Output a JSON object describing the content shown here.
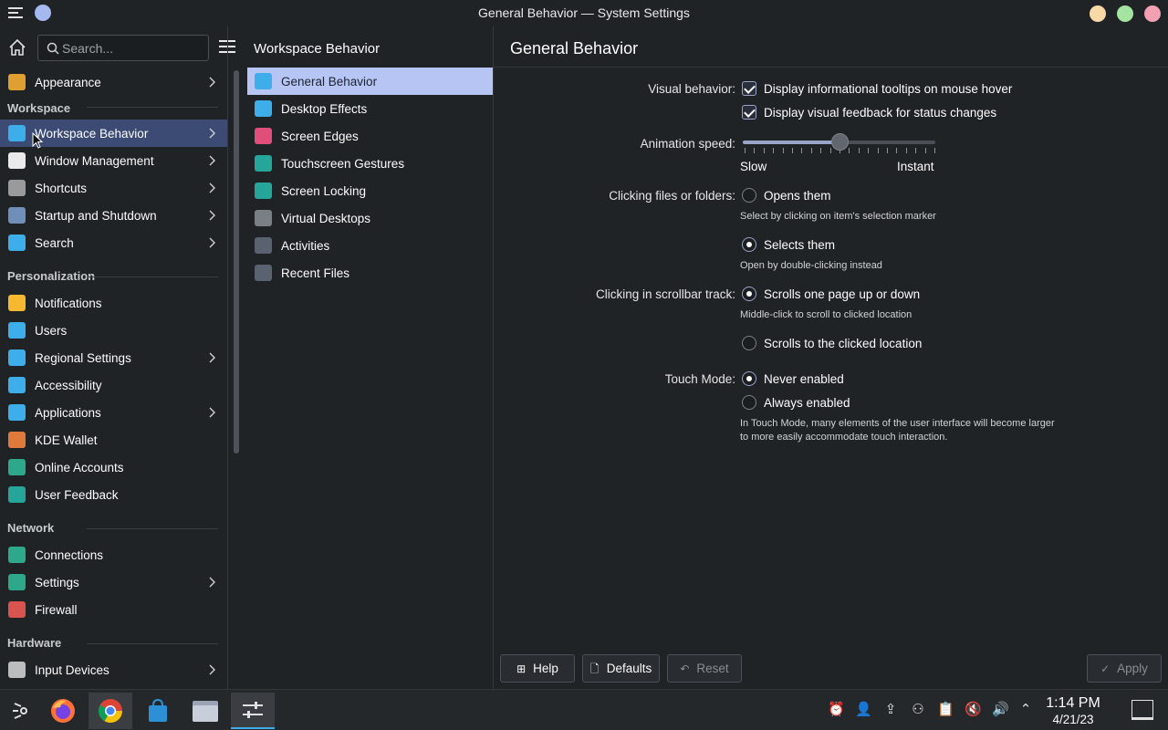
{
  "window": {
    "title": "General Behavior — System Settings"
  },
  "search": {
    "placeholder": "Search..."
  },
  "sidebar": {
    "items": [
      {
        "type": "item",
        "label": "Appearance",
        "chevron": true,
        "icon": "appearance-icon",
        "color": "#e0a030"
      },
      {
        "type": "section",
        "label": "Workspace"
      },
      {
        "type": "item",
        "label": "Workspace Behavior",
        "chevron": true,
        "active": true,
        "icon": "workspace-behavior-icon",
        "color": "#3daee9"
      },
      {
        "type": "item",
        "label": "Window Management",
        "chevron": true,
        "icon": "window-management-icon",
        "color": "#eaeaea"
      },
      {
        "type": "item",
        "label": "Shortcuts",
        "chevron": true,
        "icon": "keyboard-icon",
        "color": "#9a9a9a"
      },
      {
        "type": "item",
        "label": "Startup and Shutdown",
        "chevron": true,
        "icon": "startup-icon",
        "color": "#6f8fb8"
      },
      {
        "type": "item",
        "label": "Search",
        "chevron": true,
        "icon": "search-icon",
        "color": "#3daee9"
      },
      {
        "type": "section",
        "label": "Personalization"
      },
      {
        "type": "item",
        "label": "Notifications",
        "icon": "bell-icon",
        "color": "#f5b82e"
      },
      {
        "type": "item",
        "label": "Users",
        "icon": "users-icon",
        "color": "#3daee9"
      },
      {
        "type": "item",
        "label": "Regional Settings",
        "chevron": true,
        "icon": "regional-icon",
        "color": "#3daee9"
      },
      {
        "type": "item",
        "label": "Accessibility",
        "icon": "accessibility-icon",
        "color": "#3daee9"
      },
      {
        "type": "item",
        "label": "Applications",
        "chevron": true,
        "icon": "applications-icon",
        "color": "#3daee9"
      },
      {
        "type": "item",
        "label": "KDE Wallet",
        "icon": "wallet-icon",
        "color": "#e07a3a"
      },
      {
        "type": "item",
        "label": "Online Accounts",
        "icon": "online-accounts-icon",
        "color": "#2ea88a"
      },
      {
        "type": "item",
        "label": "User Feedback",
        "icon": "feedback-icon",
        "color": "#26a69a"
      },
      {
        "type": "section",
        "label": "Network"
      },
      {
        "type": "item",
        "label": "Connections",
        "icon": "connections-icon",
        "color": "#2ea88a"
      },
      {
        "type": "item",
        "label": "Settings",
        "chevron": true,
        "icon": "network-settings-icon",
        "color": "#2ea88a"
      },
      {
        "type": "item",
        "label": "Firewall",
        "icon": "firewall-icon",
        "color": "#d9534f"
      },
      {
        "type": "section",
        "label": "Hardware"
      },
      {
        "type": "item",
        "label": "Input Devices",
        "chevron": true,
        "icon": "mouse-icon",
        "color": "#bdbdbd"
      }
    ]
  },
  "midpanel": {
    "title": "Workspace Behavior",
    "items": [
      {
        "label": "General Behavior",
        "active": true,
        "icon": "general-behavior-icon",
        "color": "#3daee9"
      },
      {
        "label": "Desktop Effects",
        "icon": "desktop-effects-icon",
        "color": "#3daee9"
      },
      {
        "label": "Screen Edges",
        "icon": "screen-edges-icon",
        "color": "#e04f7a"
      },
      {
        "label": "Touchscreen Gestures",
        "icon": "touchscreen-icon",
        "color": "#26a69a"
      },
      {
        "label": "Screen Locking",
        "icon": "screen-lock-icon",
        "color": "#26a69a"
      },
      {
        "label": "Virtual Desktops",
        "icon": "virtual-desktops-icon",
        "color": "#7a7f86"
      },
      {
        "label": "Activities",
        "icon": "activities-icon",
        "color": "#5a6270"
      },
      {
        "label": "Recent Files",
        "icon": "recent-files-icon",
        "color": "#5a6270"
      }
    ]
  },
  "content": {
    "title": "General Behavior",
    "visual": {
      "label": "Visual behavior:",
      "opt1": "Display informational tooltips on mouse hover",
      "opt2": "Display visual feedback for status changes"
    },
    "animation": {
      "label": "Animation speed:",
      "min_label": "Slow",
      "max_label": "Instant",
      "value_fraction": 0.5
    },
    "clicking": {
      "label": "Clicking files or folders:",
      "opt1": "Opens them",
      "hint1": "Select by clicking on item's selection marker",
      "opt2": "Selects them",
      "hint2": "Open by double-clicking instead"
    },
    "scrollbar": {
      "label": "Clicking in scrollbar track:",
      "opt1": "Scrolls one page up or down",
      "hint1": "Middle-click to scroll to clicked location",
      "opt2": "Scrolls to the clicked location"
    },
    "touch": {
      "label": "Touch Mode:",
      "opt1": "Never enabled",
      "opt2": "Always enabled",
      "hint": "In Touch Mode, many elements of the user interface will become larger to more easily accommodate touch interaction."
    }
  },
  "buttons": {
    "help": "Help",
    "defaults": "Defaults",
    "reset": "Reset",
    "apply": "Apply"
  },
  "taskbar": {
    "time": "1:14 PM",
    "date": "4/21/23"
  },
  "colors": {
    "accent": "#3daee9",
    "selection": "#b6c5f4",
    "background": "#202326"
  }
}
